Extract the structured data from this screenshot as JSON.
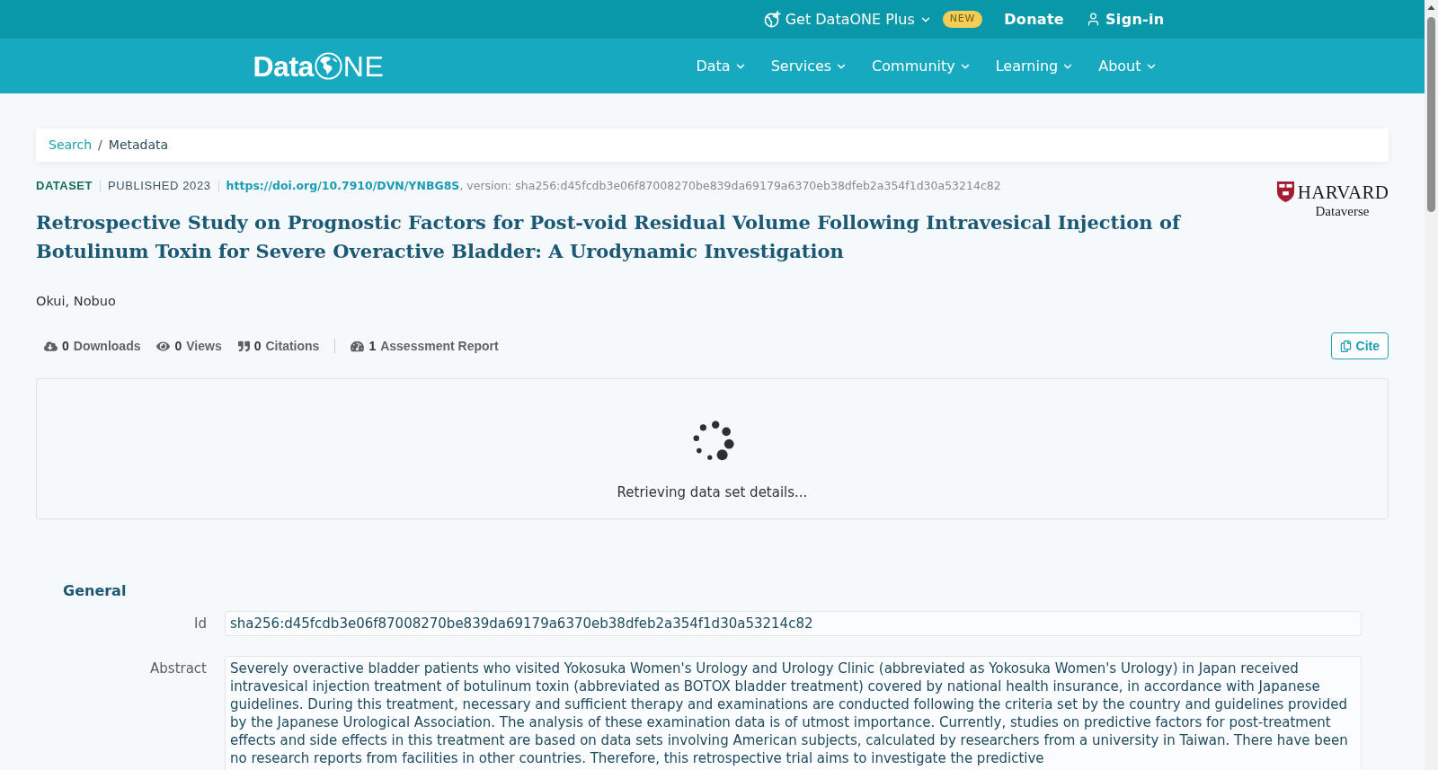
{
  "top_bar": {
    "items": [
      {
        "kind": "menu",
        "label": "Get DataONE Plus",
        "badge": "NEW"
      },
      {
        "kind": "link",
        "label": "Donate"
      },
      {
        "kind": "account",
        "label": "Sign-in"
      }
    ]
  },
  "nav": {
    "logo": {
      "lead": "Data",
      "tail": "NE"
    },
    "items": [
      {
        "label": "Data"
      },
      {
        "label": "Services"
      },
      {
        "label": "Community"
      },
      {
        "label": "Learning"
      },
      {
        "label": "About"
      }
    ]
  },
  "breadcrumb": {
    "separator": "/",
    "items": [
      {
        "kind": "link",
        "label": "Search"
      },
      {
        "kind": "current",
        "label": "Metadata"
      }
    ]
  },
  "dataset": {
    "type": "DATASET",
    "published": "PUBLISHED 2023",
    "doi": "https://doi.org/10.7910/DVN/YNBG8S",
    "version": ", version: sha256:d45fcdb3e06f87008270be839da69179a6370eb38dfeb2a354f1d30a53214c82",
    "title": "Retrospective Study on Prognostic Factors for Post-void Residual Volume Following Intravesical Injection of Botulinum Toxin for Severe Overactive Bladder: A Urodynamic Investigation",
    "repository": {
      "name": "HARVARD",
      "subtitle": "Dataverse"
    },
    "authors": "Okui, Nobuo"
  },
  "metrics": [
    {
      "kind": "downloads",
      "count": "0",
      "label": "Downloads"
    },
    {
      "kind": "views",
      "count": "0",
      "label": "Views"
    },
    {
      "kind": "citations",
      "count": "0",
      "label": "Citations"
    },
    {
      "kind": "assessment",
      "count": "1",
      "label": "Assessment Report"
    }
  ],
  "cite_button": "Cite",
  "loading": {
    "message": "Retrieving data set details..."
  },
  "sections": [
    {
      "heading": "General",
      "fields": [
        {
          "label": "Id",
          "value": "sha256:d45fcdb3e06f87008270be839da69179a6370eb38dfeb2a354f1d30a53214c82"
        },
        {
          "label": "Abstract",
          "value": "Severely overactive bladder patients who visited Yokosuka Women's Urology and Urology Clinic (abbreviated as Yokosuka Women's Urology) in Japan received intravesical injection treatment of botulinum toxin (abbreviated as BOTOX bladder treatment) covered by national health insurance, in accordance with Japanese guidelines. During this treatment, necessary and sufficient therapy and examinations are conducted following the criteria set by the country and guidelines provided by the Japanese Urological Association. The analysis of these examination data is of utmost importance. Currently, studies on predictive factors for post-treatment effects and side effects in this treatment are based on data sets involving American subjects, calculated by researchers from a university in Taiwan. There have been no research reports from facilities in other countries. Therefore, this retrospective trial aims to investigate the predictive"
        }
      ]
    }
  ]
}
